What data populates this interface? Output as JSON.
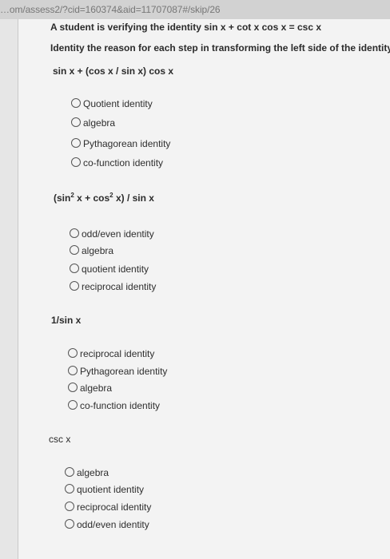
{
  "browser": {
    "url": "…om/assess2/?cid=160374&aid=11707087#/skip/26"
  },
  "question": {
    "title": "A student is verifying the identity sin x + cot x cos x = csc x",
    "instruction": "Identity the reason for each step in transforming the left side of the identity:"
  },
  "steps": [
    {
      "expression": "sin x + (cos x / sin x) cos x",
      "options": [
        "Quotient identity",
        "algebra",
        "Pythagorean identity",
        "co-function identity"
      ]
    },
    {
      "expression_parts": [
        "(sin",
        "2",
        " x + cos",
        "2",
        " x) / sin x"
      ],
      "options": [
        "odd/even identity",
        "algebra",
        "quotient identity",
        "reciprocal identity"
      ]
    },
    {
      "expression": "1/sin x",
      "options": [
        "reciprocal identity",
        "Pythagorean identity",
        "algebra",
        "co-function identity"
      ]
    },
    {
      "expression": "csc x",
      "options": [
        "algebra",
        "quotient identity",
        "reciprocal identity",
        "odd/even identity"
      ]
    }
  ]
}
